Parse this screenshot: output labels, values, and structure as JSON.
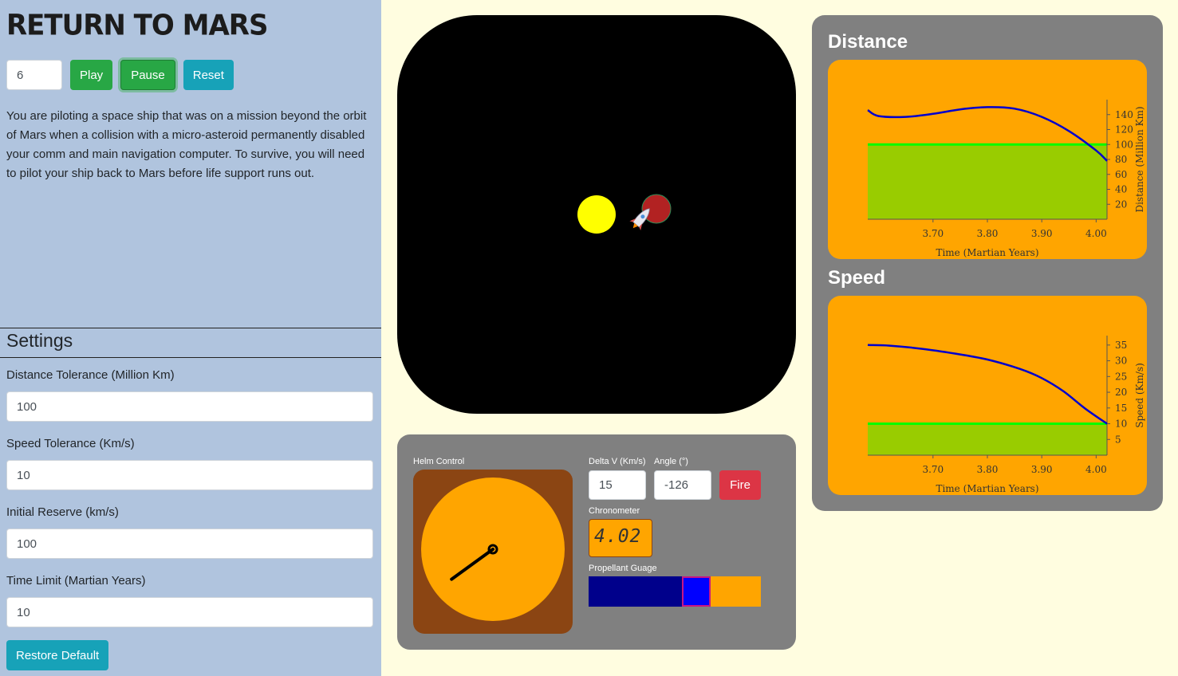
{
  "app": {
    "title": "RETURN TO MARS"
  },
  "controls": {
    "speed_value": "6",
    "play_label": "Play",
    "pause_label": "Pause",
    "reset_label": "Reset"
  },
  "intro_text": "You are piloting a space ship that was on a mission beyond the orbit of Mars when a collision with a micro-asteroid permanently disabled your comm and main navigation computer. To survive, you will need to pilot your ship back to Mars before life support runs out.",
  "settings": {
    "heading": "Settings",
    "fields": [
      {
        "label": "Distance Tolerance (Million Km)",
        "value": "100"
      },
      {
        "label": "Speed Tolerance (Km/s)",
        "value": "10"
      },
      {
        "label": "Initial Reserve (km/s)",
        "value": "100"
      },
      {
        "label": "Time Limit (Martian Years)",
        "value": "10"
      }
    ],
    "restore_label": "Restore Default"
  },
  "space_view": {
    "sun_color": "#ffff00",
    "mars_color": "#b22222",
    "ship_icon": "rocket-icon"
  },
  "helm": {
    "helm_label": "Helm Control",
    "delta_v_label": "Delta V (Km/s)",
    "delta_v_value": "15",
    "angle_label": "Angle (°)",
    "angle_value": "-126",
    "fire_label": "Fire",
    "chronometer_label": "Chronometer",
    "chronometer_value": "4.02",
    "propellant_label": "Propellant Guage",
    "propellant_fraction": 0.54,
    "dial_angle_deg": -126
  },
  "chart_data": [
    {
      "type": "line",
      "title": "Distance",
      "xlabel": "Time (Martian Years)",
      "ylabel": "Distance (Million Km)",
      "xlim": [
        3.58,
        4.02
      ],
      "ylim": [
        0,
        160
      ],
      "x_ticks": [
        3.7,
        3.8,
        3.9,
        4.0
      ],
      "x_tick_labels": [
        "3.70",
        "3.80",
        "3.90",
        "4.00"
      ],
      "y_ticks": [
        20,
        40,
        60,
        80,
        100,
        120,
        140
      ],
      "tolerance": 100,
      "series": [
        {
          "color": "#0000cd",
          "x": [
            3.58,
            3.6,
            3.65,
            3.7,
            3.75,
            3.8,
            3.85,
            3.9,
            3.95,
            4.0,
            4.02
          ],
          "y": [
            146,
            138,
            137,
            141,
            147,
            150,
            148,
            137,
            118,
            92,
            78
          ]
        }
      ]
    },
    {
      "type": "line",
      "title": "Speed",
      "xlabel": "Time (Martian Years)",
      "ylabel": "Speed (Km/s)",
      "xlim": [
        3.58,
        4.02
      ],
      "ylim": [
        0,
        38
      ],
      "x_ticks": [
        3.7,
        3.8,
        3.9,
        4.0
      ],
      "x_tick_labels": [
        "3.70",
        "3.80",
        "3.90",
        "4.00"
      ],
      "y_ticks": [
        5,
        10,
        15,
        20,
        25,
        30,
        35
      ],
      "tolerance": 10,
      "series": [
        {
          "color": "#0000cd",
          "x": [
            3.58,
            3.62,
            3.68,
            3.74,
            3.8,
            3.86,
            3.9,
            3.94,
            3.98,
            4.02
          ],
          "y": [
            35,
            34.8,
            33.8,
            32.3,
            30.4,
            27.4,
            24.5,
            20.3,
            14.8,
            10
          ]
        }
      ]
    }
  ]
}
